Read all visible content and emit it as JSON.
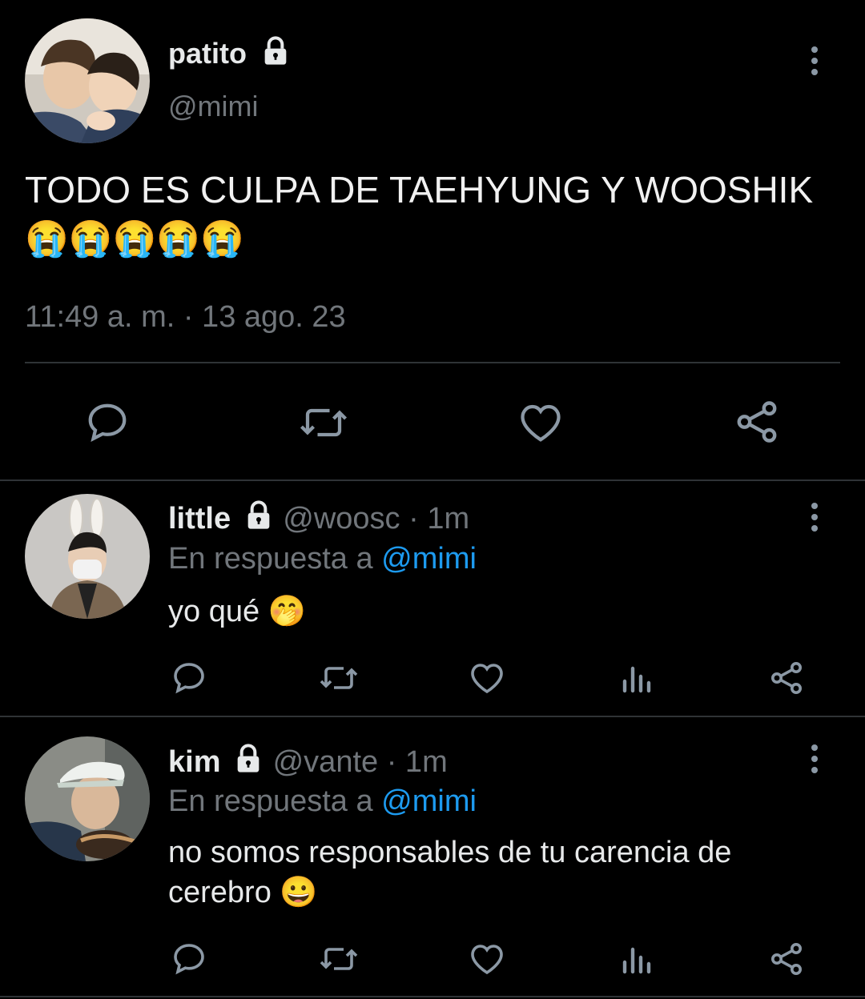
{
  "main_tweet": {
    "display_name": "patito",
    "handle": "@mimi",
    "text": "TODO ES CULPA DE TAEHYUNG Y WOOSHIK",
    "emoji_text": "😭😭😭😭😭",
    "timestamp": "11:49 a. m. · 13 ago. 23"
  },
  "replies": [
    {
      "display_name": "little",
      "handle": "@woosc",
      "time": "· 1m",
      "reply_prefix": "En respuesta a",
      "reply_to": "@mimi",
      "text": "yo qué",
      "emoji": "🤭"
    },
    {
      "display_name": "kim",
      "handle": "@vante",
      "time": "· 1m",
      "reply_prefix": "En respuesta a",
      "reply_to": "@mimi",
      "text_line1": "no somos responsables de tu carencia de",
      "text_line2": "cerebro",
      "emoji": "😀"
    }
  ],
  "icons": [
    "lock-icon",
    "more-icon",
    "reply-icon",
    "retweet-icon",
    "like-icon",
    "share-icon",
    "views-icon"
  ],
  "colors": {
    "background": "#000000",
    "text": "#e7e9ea",
    "muted": "#71767b",
    "link": "#1d9bf0",
    "divider": "#2f3336"
  }
}
